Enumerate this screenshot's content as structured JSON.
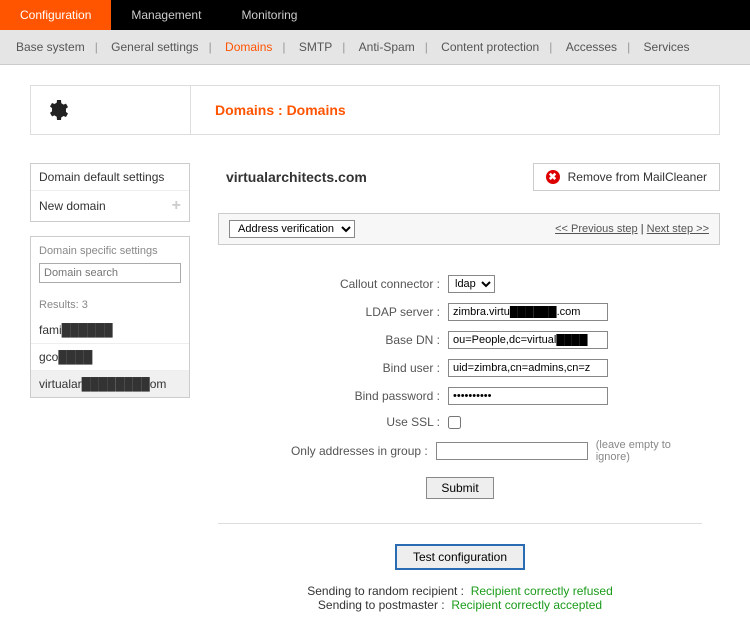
{
  "topnav": {
    "configuration": "Configuration",
    "management": "Management",
    "monitoring": "Monitoring"
  },
  "subnav": {
    "base_system": "Base system",
    "general_settings": "General settings",
    "domains": "Domains",
    "smtp": "SMTP",
    "anti_spam": "Anti-Spam",
    "content_protection": "Content protection",
    "accesses": "Accesses",
    "services": "Services"
  },
  "page_title": "Domains : Domains",
  "sidebar": {
    "default_settings": "Domain default settings",
    "new_domain": "New domain",
    "specific_settings": "Domain specific settings",
    "search_placeholder": "Domain search",
    "results_label": "Results: 3",
    "items": [
      "fami██████",
      "gco████",
      "virtualar████████om"
    ]
  },
  "domain_title": "virtualarchitects.com",
  "remove_label": "Remove from MailCleaner",
  "step_selector": "Address verification",
  "step_prev": "<< Previous step",
  "step_next": "Next step >>",
  "form": {
    "callout_connector": {
      "label": "Callout connector :",
      "value": "ldap"
    },
    "ldap_server": {
      "label": "LDAP server :",
      "value": "zimbra.virtu██████.com"
    },
    "base_dn": {
      "label": "Base DN :",
      "value": "ou=People,dc=virtual████"
    },
    "bind_user": {
      "label": "Bind user :",
      "value": "uid=zimbra,cn=admins,cn=z"
    },
    "bind_password": {
      "label": "Bind password :",
      "value": "••••••••••"
    },
    "use_ssl": {
      "label": "Use SSL :",
      "checked": false
    },
    "only_group": {
      "label": "Only addresses in group :",
      "value": "",
      "hint": "(leave empty to ignore)"
    },
    "submit": "Submit"
  },
  "test_btn": "Test configuration",
  "results": {
    "r1_lbl": "Sending to random recipient :",
    "r1_val": "Recipient correctly refused",
    "r2_lbl": "Sending to postmaster :",
    "r2_val": "Recipient correctly accepted"
  }
}
